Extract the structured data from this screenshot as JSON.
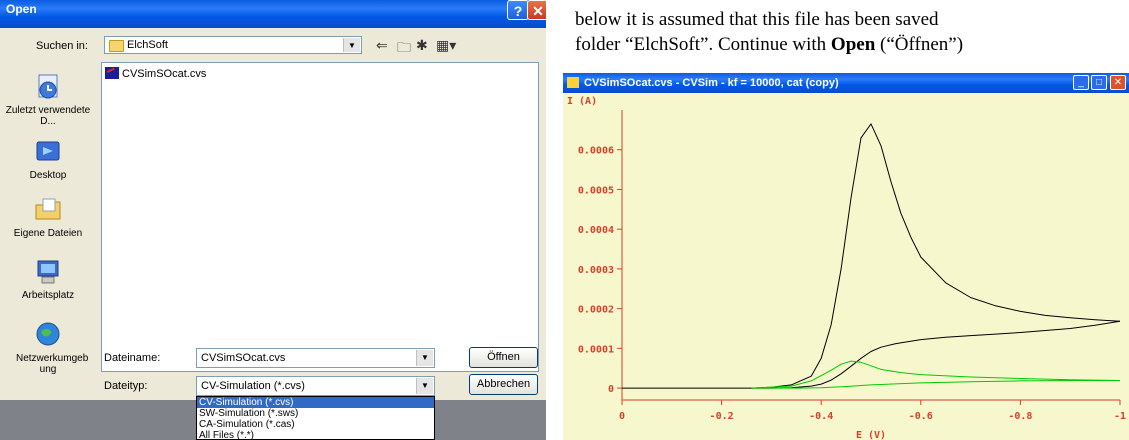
{
  "open_dialog": {
    "title": "Open",
    "help_label": "?",
    "close_label": "✕",
    "look_in_label": "Suchen in:",
    "look_in_value": "ElchSoft",
    "places": [
      {
        "label": "Zuletzt verwendete D...",
        "icon": "recent-docs-icon"
      },
      {
        "label": "Desktop",
        "icon": "desktop-icon"
      },
      {
        "label": "Eigene Dateien",
        "icon": "my-documents-icon"
      },
      {
        "label": "Arbeitsplatz",
        "icon": "my-computer-icon"
      },
      {
        "label": "Netzwerkumgeb ung",
        "icon": "network-icon"
      }
    ],
    "files": [
      {
        "name": "CVSimSOcat.cvs"
      }
    ],
    "filename_label": "Dateiname:",
    "filename_value": "CVSimSOcat.cvs",
    "filetype_label": "Dateityp:",
    "filetype_value": "CV-Simulation (*.cvs)",
    "open_button": "Öffnen",
    "cancel_button": "Abbrechen",
    "filetype_options": [
      "CV-Simulation (*.cvs)",
      "SW-Simulation (*.sws)",
      "CA-Simulation (*.cas)",
      "All Files (*.*)"
    ]
  },
  "paragraph": {
    "line1": "below it is assumed that this file has been saved",
    "line2_pre": "folder “ElchSoft”. Continue with ",
    "line2_bold": "Open",
    "line2_post": " (“Öffnen”)"
  },
  "cv_window": {
    "title": "CVSimSOcat.cvs - CVSim - kf = 10000, cat (copy)",
    "min_label": "_",
    "max_label": "□",
    "close_label": "✕"
  },
  "chart_data": {
    "type": "line",
    "ylabel": "I (A)",
    "xlabel": "E (V)",
    "xlim": [
      0,
      -1
    ],
    "ylim": [
      -3e-05,
      0.0007
    ],
    "x_ticks": [
      "0",
      "-0.2",
      "-0.4",
      "-0.6",
      "-0.8",
      "-1"
    ],
    "y_ticks": [
      "0",
      "0.0001",
      "0.0002",
      "0.0003",
      "0.0004",
      "0.0005",
      "0.0006"
    ],
    "colors": {
      "black": "#000000",
      "green": "#00cc00",
      "axis": "#d6402a",
      "background": "#f7f7cd"
    },
    "series": [
      {
        "color": "black",
        "x": [
          0,
          -0.26,
          -0.3,
          -0.34,
          -0.38,
          -0.4,
          -0.42,
          -0.44,
          -0.46,
          -0.48,
          -0.5,
          -0.52,
          -0.54,
          -0.56,
          -0.58,
          -0.6,
          -0.65,
          -0.7,
          -0.75,
          -0.8,
          -0.85,
          -0.9,
          -0.95,
          -1.0
        ],
        "y": [
          0,
          0,
          2e-06,
          8e-06,
          3e-05,
          7.5e-05,
          0.00016,
          0.0003,
          0.00048,
          0.00063,
          0.000665,
          0.00061,
          0.00052,
          0.00044,
          0.00038,
          0.00033,
          0.000265,
          0.000228,
          0.000207,
          0.000193,
          0.000183,
          0.000177,
          0.000172,
          0.000168
        ]
      },
      {
        "color": "black",
        "x": [
          -1.0,
          -0.95,
          -0.9,
          -0.85,
          -0.8,
          -0.75,
          -0.7,
          -0.65,
          -0.6,
          -0.55,
          -0.52,
          -0.5,
          -0.48,
          -0.46,
          -0.44,
          -0.42,
          -0.4,
          -0.38,
          -0.34,
          -0.3,
          -0.26
        ],
        "y": [
          0.000168,
          0.000158,
          0.00015,
          0.000145,
          0.00014,
          0.000136,
          0.000132,
          0.000128,
          0.000122,
          0.000112,
          0.000103,
          9.2e-05,
          7.5e-05,
          5.5e-05,
          3.6e-05,
          2e-05,
          1e-05,
          5e-06,
          1e-06,
          0,
          0
        ]
      },
      {
        "color": "green",
        "x": [
          -0.26,
          -0.34,
          -0.38,
          -0.42,
          -0.44,
          -0.46,
          -0.48,
          -0.5,
          -0.52,
          -0.56,
          -0.6,
          -0.7,
          -0.8,
          -0.9,
          -1.0
        ],
        "y": [
          0,
          5e-06,
          1.8e-05,
          4.5e-05,
          6e-05,
          6.8e-05,
          6.5e-05,
          5.6e-05,
          4.7e-05,
          3.9e-05,
          3.4e-05,
          2.8e-05,
          2.4e-05,
          2.1e-05,
          1.9e-05
        ]
      },
      {
        "color": "green",
        "x": [
          -1.0,
          -0.9,
          -0.8,
          -0.7,
          -0.6,
          -0.5,
          -0.45,
          -0.4,
          -0.35,
          -0.3,
          -0.26
        ],
        "y": [
          1.9e-05,
          1.9e-05,
          1.8e-05,
          1.6e-05,
          1.3e-05,
          8e-06,
          4e-06,
          1e-06,
          0,
          0,
          0
        ]
      }
    ]
  }
}
